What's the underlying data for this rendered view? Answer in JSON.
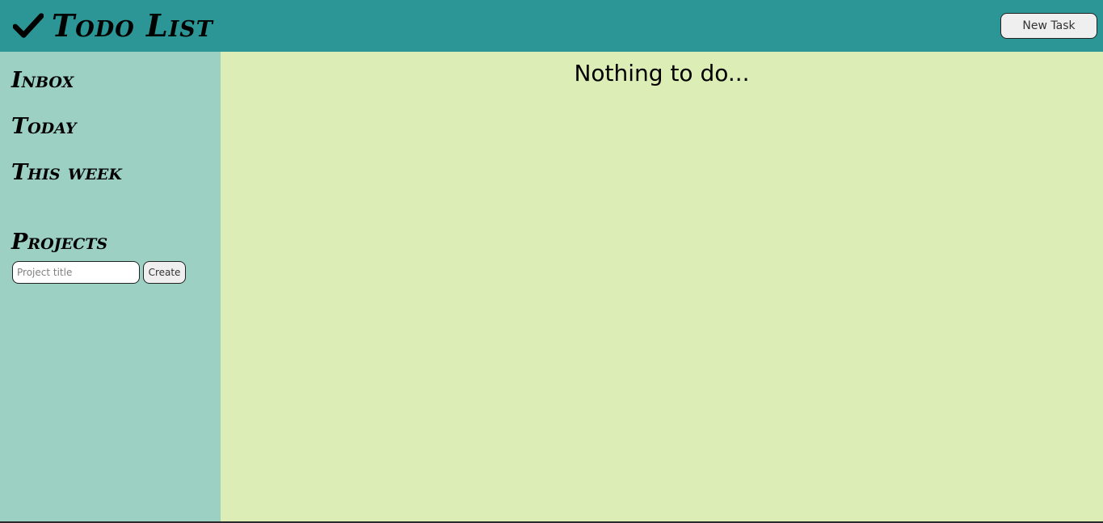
{
  "header": {
    "title": "Todo List",
    "new_task_label": "New Task"
  },
  "sidebar": {
    "items": [
      {
        "label": "Inbox"
      },
      {
        "label": "Today"
      },
      {
        "label": "This week"
      }
    ],
    "projects_heading": "Projects",
    "project_input_placeholder": "Project title",
    "project_input_value": "",
    "create_label": "Create"
  },
  "main": {
    "empty_message": "Nothing to do..."
  },
  "icons": {
    "logo": "check-icon"
  },
  "colors": {
    "header_bg": "#2c9596",
    "sidebar_bg": "#9bd0c3",
    "main_bg": "#dcedb5"
  }
}
